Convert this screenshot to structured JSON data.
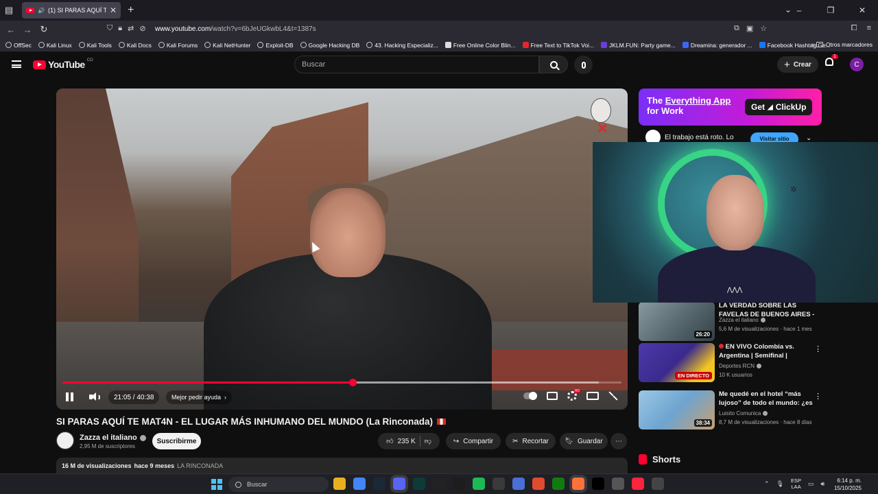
{
  "browser": {
    "tab_title": "(1) SI PARAS AQUÍ TE MAT4N",
    "url_host": "www.youtube.com",
    "url_path": "/watch?v=6bJeUGkwbL4&t=1387s",
    "bookmarks": [
      "OffSec",
      "Kali Linux",
      "Kali Tools",
      "Kali Docs",
      "Kali Forums",
      "Kali NetHunter",
      "Exploit-DB",
      "Google Hacking DB",
      "43. Hacking Especializ...",
      "Free Online Color Blin...",
      "Free Text to TikTok Voi...",
      "JKLM.FUN: Party game...",
      "Dreamina: generador ...",
      "Facebook Hashtag Ge..."
    ],
    "other_bookmarks": "Otros marcadores"
  },
  "youtube": {
    "logo_text": "YouTube",
    "logo_country": "CO",
    "search_placeholder": "Buscar",
    "create_label": "Crear",
    "notifications_count": "1",
    "avatar_letter": "C"
  },
  "player": {
    "current_time": "21:05",
    "duration": "40:38",
    "time_label": "21:05 / 40:38",
    "chapter_label": "Mejor pedir ayuda",
    "played_fraction": 0.519,
    "loaded_fraction": 0.96,
    "hd_badge": "HD"
  },
  "video": {
    "title": "SI PARAS AQUÍ TE MAT4N - EL LUGAR MÁS INHUMANO DEL MUNDO (La Rinconada)",
    "channel_name": "Zazza el italiano",
    "subscribers": "2,95 M de suscriptores",
    "subscribe_label": "Suscribirme",
    "likes": "235 K",
    "share_label": "Compartir",
    "clip_label": "Recortar",
    "save_label": "Guardar",
    "views": "16 M de visualizaciones",
    "published": "hace 9 meses",
    "hashtag": "LA RINCONADA"
  },
  "ad": {
    "headline_part1": "The ",
    "headline_underlined": "Everything App",
    "headline_part2": "for Work",
    "cta": "Get",
    "brand": "ClickUp",
    "line": "El trabajo está roto. Lo",
    "visit_label": "Visitar sitio"
  },
  "recommendations": [
    {
      "title": "LA VERDAD SOBRE LAS FAVELAS DE BUENOS AIRES - ¡Aquí NO ...",
      "channel": "Zazza el italiano",
      "views": "5,6 M de visualizaciones",
      "age": "hace 1 mes",
      "duration": "26:20",
      "color": "#5a6b72"
    },
    {
      "title": "EN VIVO Colombia vs. Argentina | Semifinal | Mundial...",
      "channel": "Deportes RCN",
      "views": "10 K usuarios",
      "age": "",
      "live_label": "EN DIRECTO",
      "color": "#3b2a8c"
    },
    {
      "title": "Me quedé en el hotel “más lujoso” de todo el mundo: ¿es ...",
      "channel": "Luisito Comunica",
      "views": "8,7 M de visualizaciones",
      "age": "hace 8 días",
      "duration": "38:34",
      "color": "#6ea4cf"
    }
  ],
  "shorts_label": "Shorts",
  "taskbar": {
    "search_placeholder": "Buscar",
    "lang_line1": "ESP",
    "lang_line2": "LAA",
    "time": "6:14 p. m.",
    "date": "15/10/2025",
    "app_colors": [
      "#e8b01e",
      "#4285f4",
      "#1b2838",
      "#5865f2",
      "#0e3b37",
      "#222",
      "#1d1d1d",
      "#1db954",
      "#3a3a3a",
      "#4a6fd6",
      "#e04b2f",
      "#107c10",
      "#ff7139",
      "#000",
      "#555",
      "#fa243c",
      "#444"
    ]
  }
}
